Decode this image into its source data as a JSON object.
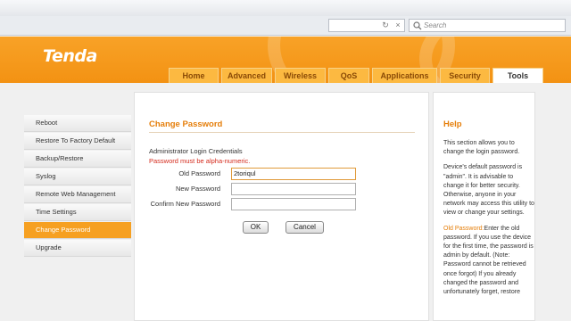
{
  "browser": {
    "search_placeholder": "Search",
    "reload_icon": "reload-icon",
    "close_icon": "close-icon"
  },
  "brand": {
    "logo_text": "Tenda",
    "accent": "#f39213"
  },
  "tabs": [
    {
      "label": "Home"
    },
    {
      "label": "Advanced"
    },
    {
      "label": "Wireless"
    },
    {
      "label": "QoS"
    },
    {
      "label": "Applications"
    },
    {
      "label": "Security"
    },
    {
      "label": "Tools",
      "active": true
    }
  ],
  "sidebar": {
    "items": [
      {
        "label": "Reboot"
      },
      {
        "label": "Restore To Factory Default"
      },
      {
        "label": "Backup/Restore"
      },
      {
        "label": "Syslog"
      },
      {
        "label": "Remote Web Management"
      },
      {
        "label": "Time Settings"
      },
      {
        "label": "Change Password",
        "active": true
      },
      {
        "label": "Upgrade"
      }
    ]
  },
  "form": {
    "title": "Change Password",
    "subtitle": "Administrator Login Credentials",
    "warning": "Password must be alpha-numeric.",
    "old_label": "Old Password",
    "old_value": "2toriqul",
    "new_label": "New Password",
    "new_value": "",
    "confirm_label": "Confirm New Password",
    "confirm_value": "",
    "ok_label": "OK",
    "cancel_label": "Cancel"
  },
  "help": {
    "title": "Help",
    "p1": "This section allows you to change the login password.",
    "p2": "Device's default password is \"admin\". It is advisable to change it for better security. Otherwise, anyone in your network may access this utility to view or change your settings.",
    "p3_label": "Old Password:",
    "p3": "Enter the old password. If you use the device for the first time, the password is admin by default. (Note: Password cannot be retrieved once forgot) If you already changed the password and unfortunately forget, restore"
  }
}
